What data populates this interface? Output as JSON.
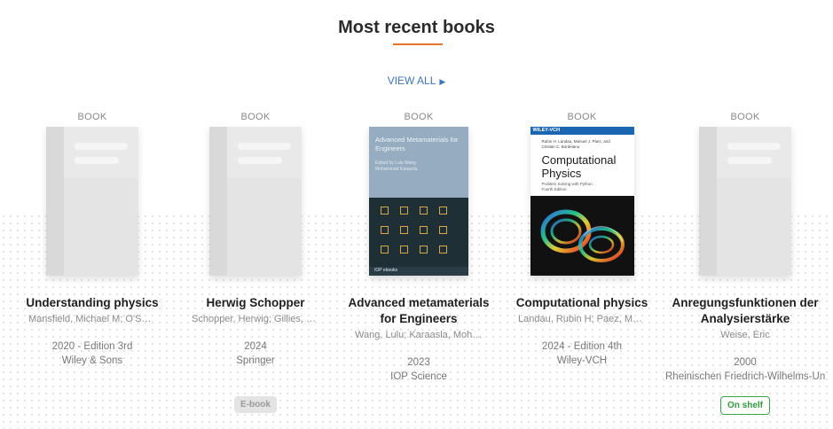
{
  "section": {
    "title": "Most recent books",
    "view_all": "VIEW ALL",
    "accent_color": "#e8732a",
    "link_color": "#3b74c4"
  },
  "books": [
    {
      "type": "BOOK",
      "title": "Understanding physics",
      "authors": "Mansfield, Michael M; O'Sullivan, Colm",
      "year": "2020 - Edition 3rd",
      "publisher": "Wiley & Sons",
      "cover": "placeholder"
    },
    {
      "type": "BOOK",
      "title": "Herwig Schopper",
      "authors": "Schopper, Herwig; Gillies, James",
      "year": "2024",
      "publisher": "Springer",
      "badge": "E-book",
      "cover": "placeholder"
    },
    {
      "type": "BOOK",
      "title": "Advanced metamaterials for Engineers",
      "authors": "Wang, Lulu; Karaasla, Mohammad",
      "year": "2023",
      "publisher": "IOP Science",
      "cover": "metamaterials",
      "cover_text": {
        "title": "Advanced Metamaterials for Engineers",
        "editors": "Edited by Lulu Wang Mohammad Karaasla",
        "footer": "IOP ebooks"
      }
    },
    {
      "type": "BOOK",
      "title": "Computational physics",
      "authors": "Landau, Rubin H; Paez, Manuel J; Bordeianu, Cristian C",
      "year": "2024 - Edition 4th",
      "publisher": "Wiley-VCH",
      "cover": "computational",
      "cover_text": {
        "publisher": "WILEY-VCH",
        "authors": "Rubin H. Landau, Manuel J. Páez, and Cristian C. Bordeianu",
        "title_line1": "Computational",
        "title_line2": "Physics",
        "subtitle": "Problem Solving with Python",
        "edition": "Fourth Edition"
      }
    },
    {
      "type": "BOOK",
      "title": "Anregungsfunktionen der Analysierstärke",
      "authors": "Weise, Eric",
      "year": "2000",
      "publisher": "Rheinischen Friedrich-Wilhelms-Universität",
      "badge": "On shelf",
      "cover": "placeholder"
    }
  ]
}
